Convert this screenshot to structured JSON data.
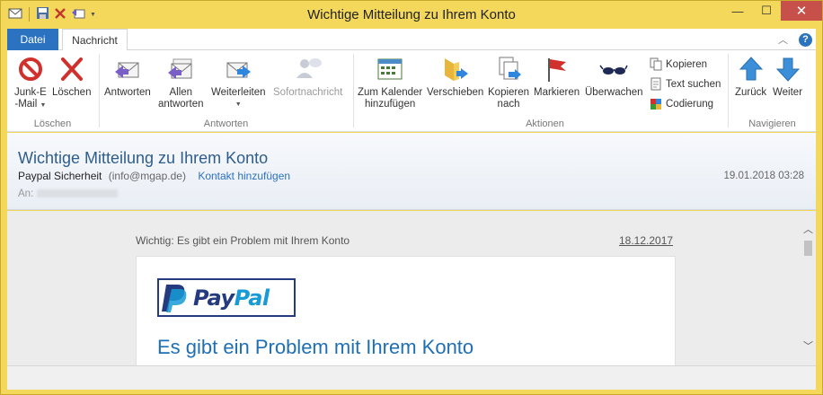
{
  "window": {
    "title": "Wichtige Mitteilung zu Ihrem Konto"
  },
  "tabs": {
    "file": "Datei",
    "message": "Nachricht"
  },
  "ribbon": {
    "groups": {
      "loeschen": "Löschen",
      "antworten": "Antworten",
      "aktionen": "Aktionen",
      "navigieren": "Navigieren"
    },
    "junk_line1": "Junk-E",
    "junk_line2": "-Mail",
    "delete": "Löschen",
    "reply": "Antworten",
    "reply_all_line1": "Allen",
    "reply_all_line2": "antworten",
    "forward": "Weiterleiten",
    "instant_message": "Sofortnachricht",
    "calendar_line1": "Zum Kalender",
    "calendar_line2": "hinzufügen",
    "move": "Verschieben",
    "copy_to_line1": "Kopieren",
    "copy_to_line2": "nach",
    "flag": "Markieren",
    "watch": "Überwachen",
    "copy": "Kopieren",
    "find_text": "Text suchen",
    "encoding": "Codierung",
    "back": "Zurück",
    "next": "Weiter"
  },
  "message": {
    "subject": "Wichtige Mitteilung zu Ihrem Konto",
    "sender_name": "Paypal Sicherheit",
    "sender_email": "(info@mgap.de)",
    "add_contact": "Kontakt hinzufügen",
    "date": "19.01.2018 03:28",
    "to_label": "An:"
  },
  "body": {
    "preheader": "Wichtig: Es gibt ein Problem mit Ihrem Konto",
    "preheader_date": "18.12.2017",
    "logo_pay": "Pay",
    "logo_pal": "Pal",
    "heading": "Es gibt ein Problem mit Ihrem Konto"
  },
  "colors": {
    "title_bar": "#f3d85c",
    "file_tab": "#2b72c1",
    "close_button": "#c7504a",
    "link": "#2b72c1",
    "paypal_dark": "#253b80",
    "paypal_light": "#179bd7"
  }
}
